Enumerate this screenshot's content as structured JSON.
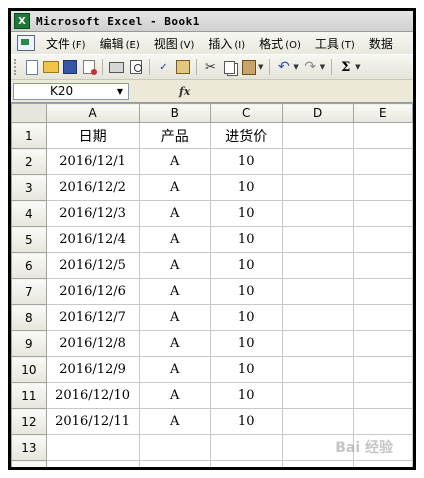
{
  "window": {
    "app_icon_letter": "X",
    "title": "Microsoft Excel - Book1"
  },
  "menu": {
    "items": [
      {
        "label": "文件",
        "key": "(F)"
      },
      {
        "label": "编辑",
        "key": "(E)"
      },
      {
        "label": "视图",
        "key": "(V)"
      },
      {
        "label": "插入",
        "key": "(I)"
      },
      {
        "label": "格式",
        "key": "(O)"
      },
      {
        "label": "工具",
        "key": "(T)"
      },
      {
        "label": "数据",
        "key": ""
      }
    ]
  },
  "toolbar": {
    "icons": [
      "new-icon",
      "open-icon",
      "save-icon",
      "permission-icon",
      "print-icon",
      "print-preview-icon",
      "spelling-icon",
      "research-icon",
      "cut-icon",
      "copy-icon",
      "paste-icon",
      "undo-icon",
      "redo-icon",
      "autosum-icon"
    ],
    "sigma": "Σ"
  },
  "formula_bar": {
    "name_box": "K20",
    "fx_label": "fx",
    "content": ""
  },
  "sheet": {
    "columns": [
      "A",
      "B",
      "C",
      "D",
      "E"
    ],
    "rows": [
      {
        "num": "1",
        "cells": [
          "日期",
          "产品",
          "进货价",
          "",
          ""
        ]
      },
      {
        "num": "2",
        "cells": [
          "2016/12/1",
          "A",
          "10",
          "",
          ""
        ]
      },
      {
        "num": "3",
        "cells": [
          "2016/12/2",
          "A",
          "10",
          "",
          ""
        ]
      },
      {
        "num": "4",
        "cells": [
          "2016/12/3",
          "A",
          "10",
          "",
          ""
        ]
      },
      {
        "num": "5",
        "cells": [
          "2016/12/4",
          "A",
          "10",
          "",
          ""
        ]
      },
      {
        "num": "6",
        "cells": [
          "2016/12/5",
          "A",
          "10",
          "",
          ""
        ]
      },
      {
        "num": "7",
        "cells": [
          "2016/12/6",
          "A",
          "10",
          "",
          ""
        ]
      },
      {
        "num": "8",
        "cells": [
          "2016/12/7",
          "A",
          "10",
          "",
          ""
        ]
      },
      {
        "num": "9",
        "cells": [
          "2016/12/8",
          "A",
          "10",
          "",
          ""
        ]
      },
      {
        "num": "10",
        "cells": [
          "2016/12/9",
          "A",
          "10",
          "",
          ""
        ]
      },
      {
        "num": "11",
        "cells": [
          "2016/12/10",
          "A",
          "10",
          "",
          ""
        ]
      },
      {
        "num": "12",
        "cells": [
          "2016/12/11",
          "A",
          "10",
          "",
          ""
        ]
      },
      {
        "num": "13",
        "cells": [
          "",
          "",
          "",
          "",
          ""
        ]
      },
      {
        "num": "",
        "cells": [
          "",
          "",
          "",
          "",
          ""
        ]
      }
    ]
  },
  "watermark": "Bai 经验"
}
